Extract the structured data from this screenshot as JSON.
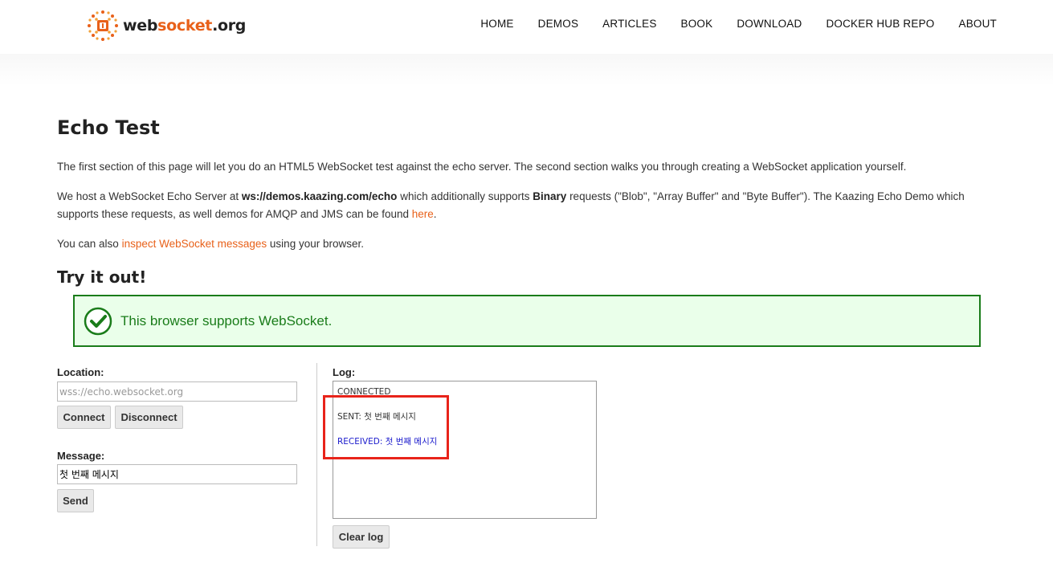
{
  "header": {
    "logo": {
      "part1": "web",
      "part2": "socket",
      "part3": ".org"
    },
    "nav": [
      "HOME",
      "DEMOS",
      "ARTICLES",
      "BOOK",
      "DOWNLOAD",
      "DOCKER HUB REPO",
      "ABOUT"
    ]
  },
  "main": {
    "title": "Echo Test",
    "intro": "The first section of this page will let you do an HTML5 WebSocket test against the echo server. The second section walks you through creating a WebSocket application yourself.",
    "host": {
      "t1": "We host a WebSocket Echo Server at ",
      "url": "ws://demos.kaazing.com/echo",
      "t2": " which additionally supports ",
      "binary": "Binary",
      "t3": " requests (\"Blob\", \"Array Buffer\" and \"Byte Buffer\"). The Kaazing Echo Demo which supports these requests, as well demos for AMQP and JMS can be found ",
      "here": "here",
      "t4": "."
    },
    "inspect": {
      "t1": "You can also ",
      "link": "inspect WebSocket messages",
      "t2": " using your browser."
    },
    "try_title": "Try it out!",
    "support_msg": "This browser supports WebSocket."
  },
  "form": {
    "location_label": "Location:",
    "location_placeholder": "wss://echo.websocket.org",
    "connect": "Connect",
    "disconnect": "Disconnect",
    "message_label": "Message:",
    "message_value": "첫 번째 메시지",
    "send": "Send"
  },
  "log": {
    "label": "Log:",
    "lines": [
      "CONNECTED",
      "SENT: 첫 번째 메시지",
      "RECEIVED: 첫 번째 메시지"
    ],
    "clear": "Clear log"
  },
  "colors": {
    "accent": "#e8611a",
    "success": "#1a7c1a",
    "received": "#1a1acc",
    "highlight": "#e8231a"
  }
}
